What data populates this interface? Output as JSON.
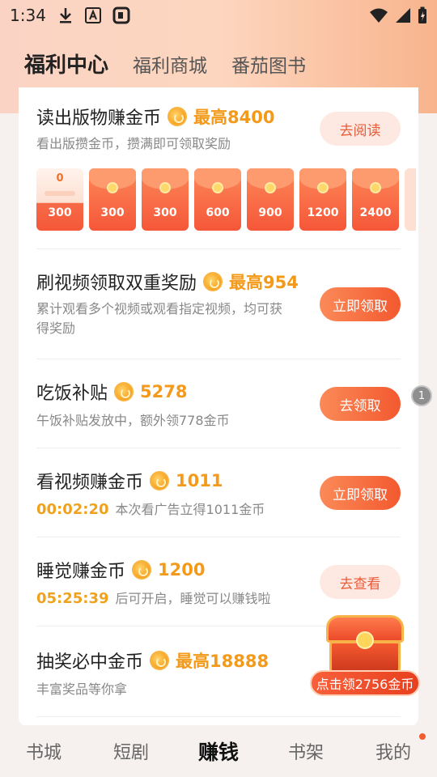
{
  "status_bar": {
    "time": "1:34"
  },
  "header": {
    "tabs": [
      {
        "label": "福利中心"
      },
      {
        "label": "福利商城"
      },
      {
        "label": "番茄图书"
      }
    ]
  },
  "tasks": {
    "read": {
      "title": "读出版物赚金币",
      "amount": "最高8400",
      "desc": "看出版攒金币，攒满即可领取奖励",
      "button": "去阅读",
      "envelopes": [
        "300",
        "300",
        "300",
        "600",
        "900",
        "1200",
        "2400"
      ],
      "first_progress": "0"
    },
    "video_double": {
      "title": "刷视频领取双重奖励",
      "amount": "最高954",
      "desc_line1": "累计观看多个视频或观看指定视频，均可获",
      "desc_line2": "得奖励",
      "button": "立即领取"
    },
    "meal": {
      "title": "吃饭补贴",
      "amount": "5278",
      "desc": "午饭补贴发放中，额外领778金币",
      "button": "去领取"
    },
    "watch_video": {
      "title": "看视频赚金币",
      "amount": "1011",
      "timer": "00:02:20",
      "desc": "本次看广告立得1011金币",
      "button": "立即领取"
    },
    "sleep": {
      "title": "睡觉赚金币",
      "amount": "1200",
      "timer": "05:25:39",
      "desc": "后可开启，睡觉可以赚钱啦",
      "button": "去查看"
    },
    "lottery": {
      "title": "抽奖必中金币",
      "amount": "最高18888",
      "desc": "丰富奖品等你拿"
    }
  },
  "floating_chest": {
    "label": "点击领2756金币"
  },
  "side_badge": {
    "count": "1"
  },
  "bottom_nav": {
    "items": [
      {
        "label": "书城"
      },
      {
        "label": "短剧"
      },
      {
        "label": "赚钱"
      },
      {
        "label": "书架"
      },
      {
        "label": "我的"
      }
    ]
  },
  "colors": {
    "accent": "#f3592f",
    "coin_text": "#f39a1b"
  }
}
